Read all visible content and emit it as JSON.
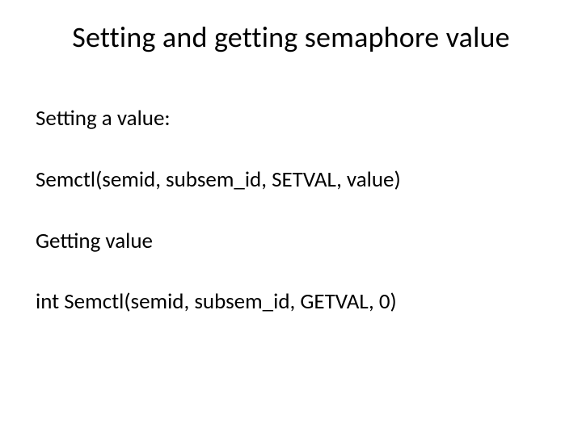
{
  "title": "Setting and getting semaphore value",
  "lines": {
    "l1": "Setting a value:",
    "l2": "Semctl(semid, subsem_id, SETVAL, value)",
    "l3": "Getting value",
    "l4": "int Semctl(semid, subsem_id, GETVAL, 0)"
  }
}
